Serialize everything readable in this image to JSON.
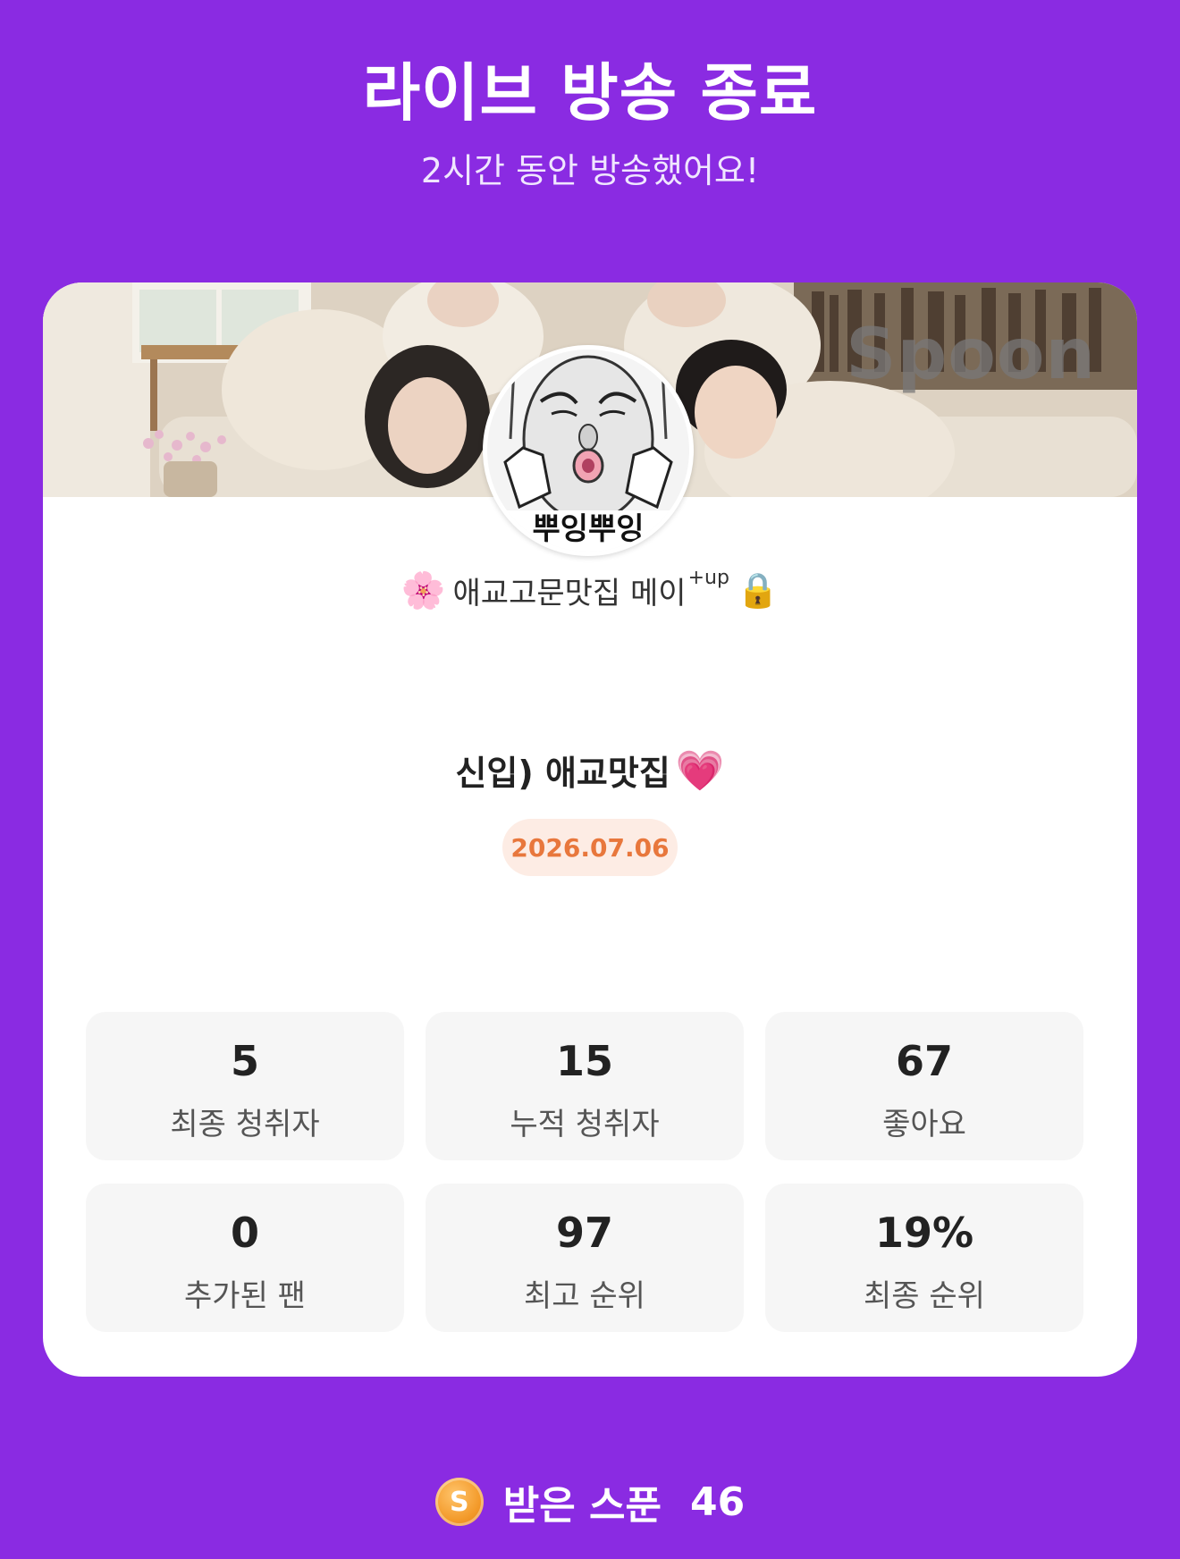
{
  "header": {
    "title": "라이브 방송 종료",
    "subtitle": "2시간 동안 방송했어요!"
  },
  "banner": {
    "watermark": "Spoon"
  },
  "host": {
    "emoji": "🌸",
    "name": "애교고문맛집 메이",
    "suffix": "+up",
    "badge": "🔒"
  },
  "broadcast": {
    "title": "신입) 애교맛집",
    "emoji": "💗",
    "date": "2026.07.06"
  },
  "stats": [
    {
      "value": "5",
      "label": "최종 청취자"
    },
    {
      "value": "15",
      "label": "누적 청취자"
    },
    {
      "value": "67",
      "label": "좋아요"
    },
    {
      "value": "0",
      "label": "추가된 팬"
    },
    {
      "value": "97",
      "label": "최고 순위"
    },
    {
      "value": "19%",
      "label": "최종 순위"
    }
  ],
  "footer": {
    "coin_symbol": "S",
    "label": "받은 스푼",
    "value": "46"
  }
}
